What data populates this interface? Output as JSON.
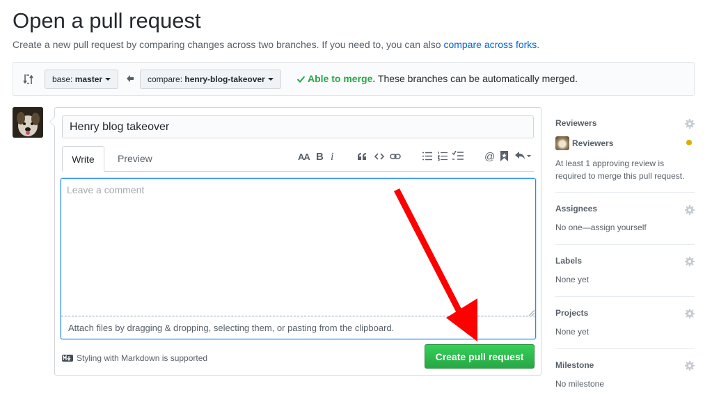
{
  "page": {
    "title": "Open a pull request",
    "subtitle_prefix": "Create a new pull request by comparing changes across two branches. If you need to, you can also ",
    "subtitle_link": "compare across forks",
    "subtitle_suffix": "."
  },
  "range": {
    "base_prefix": "base: ",
    "base_branch": "master",
    "compare_prefix": "compare: ",
    "compare_branch": "henry-blog-takeover",
    "merge_ok": "Able to merge.",
    "merge_text": " These branches can be automatically merged.",
    "merge_color": "#28a745"
  },
  "composer": {
    "title_value": "Henry blog takeover",
    "tab_write": "Write",
    "tab_preview": "Preview",
    "toolbar_icons": [
      "text-size-icon",
      "bold-icon",
      "italic-icon",
      "quote-icon",
      "code-icon",
      "link-icon",
      "unordered-list-icon",
      "ordered-list-icon",
      "task-list-icon",
      "mention-icon",
      "reference-icon",
      "reply-icon"
    ],
    "bold_glyph": "B",
    "italic_glyph": "i",
    "text_size_glyph": "AA",
    "mention_glyph": "@",
    "comment_placeholder": "Leave a comment",
    "attach_text": "Attach files by dragging & dropping, selecting them, or pasting from the clipboard.",
    "markdown_note": "Styling with Markdown is supported",
    "submit_label": "Create pull request",
    "submit_color": "#28a745"
  },
  "sidebar": {
    "reviewers_heading": "Reviewers",
    "reviewer_name": "Reviewers",
    "reviewer_note": "At least 1 approving review is required to merge this pull request.",
    "assignees_heading": "Assignees",
    "assignees_value": "No one—assign yourself",
    "labels_heading": "Labels",
    "labels_value": "None yet",
    "projects_heading": "Projects",
    "projects_value": "None yet",
    "milestone_heading": "Milestone",
    "milestone_value": "No milestone"
  },
  "annotation": {
    "arrow_color": "#ff0000"
  }
}
